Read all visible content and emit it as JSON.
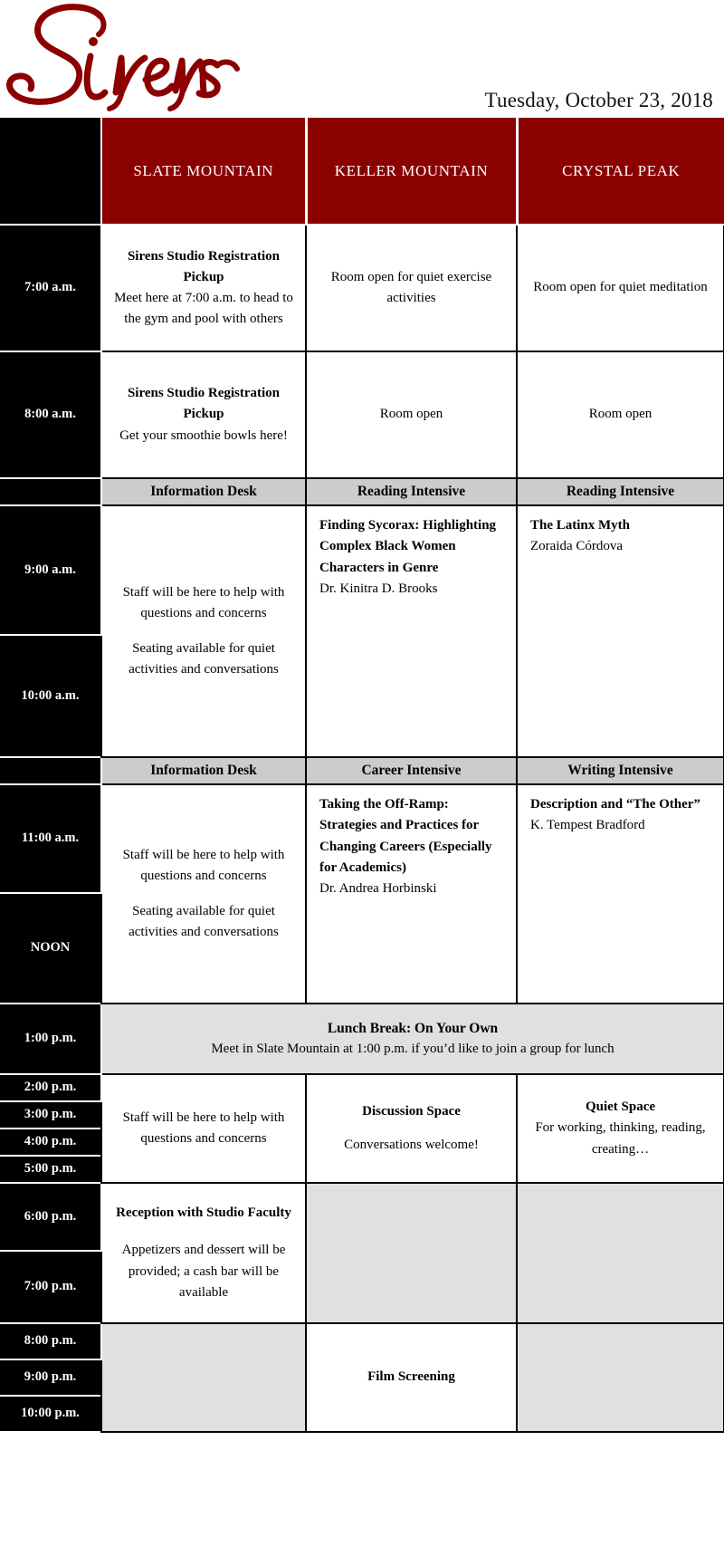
{
  "masthead": {
    "logo_text": "Sirens",
    "logo_icon": "sirens-script-logo",
    "date": "Tuesday, October 23, 2018",
    "brand_color": "#8B0000"
  },
  "colors": {
    "header_red": "#8B0000",
    "time_black": "#000000",
    "banner_gray": "#CCCCCC",
    "closed_gray": "#E0E0E0",
    "white": "#FFFFFF"
  },
  "columns": [
    {
      "key": "time",
      "label": ""
    },
    {
      "key": "slate",
      "label": "SLATE MOUNTAIN"
    },
    {
      "key": "keller",
      "label": "KELLER MOUNTAIN"
    },
    {
      "key": "crystal",
      "label": "CRYSTAL PEAK"
    }
  ],
  "times": {
    "t7": "7:00 a.m.",
    "t8": "8:00 a.m.",
    "t9": "9:00 a.m.",
    "t10": "10:00 a.m.",
    "t11": "11:00 a.m.",
    "noon": "NOON",
    "t13": "1:00 p.m.",
    "t14": "2:00 p.m.",
    "t15": "3:00 p.m.",
    "t16": "4:00 p.m.",
    "t17": "5:00 p.m.",
    "t18": "6:00 p.m.",
    "t19": "7:00 p.m.",
    "t20": "8:00 p.m.",
    "t21": "9:00 p.m.",
    "t22": "10:00 p.m."
  },
  "blocks": {
    "seven": {
      "slate_title": "Sirens Studio Registration Pickup",
      "slate_desc": "Meet here at 7:00 a.m. to head to the gym and pool with others",
      "keller": "Room open for quiet exercise activities",
      "crystal": "Room open for quiet meditation"
    },
    "eight": {
      "slate_title": "Sirens Studio Registration Pickup",
      "slate_desc": "Get your smoothie bowls here!",
      "keller": "Room open",
      "crystal": "Room open"
    },
    "morning_banner": {
      "slate": "Information Desk",
      "keller": "Reading Intensive",
      "crystal": "Reading Intensive"
    },
    "morning": {
      "slate_p1": "Staff will be here to help with questions and concerns",
      "slate_p2": "Seating available for quiet activities and conversations",
      "keller_title": "Finding Sycorax: Highlighting Complex Black Women Characters in Genre",
      "keller_presenter": "Dr. Kinitra D. Brooks",
      "crystal_title": "The Latinx Myth",
      "crystal_presenter": "Zoraida Córdova"
    },
    "midday_banner": {
      "slate": "Information Desk",
      "keller": "Career Intensive",
      "crystal": "Writing Intensive"
    },
    "midday": {
      "slate_p1": "Staff will be here to help with questions and concerns",
      "slate_p2": "Seating available for quiet activities and conversations",
      "keller_title": "Taking the Off-Ramp: Strategies and Practices for Changing Careers (Especially for Academics)",
      "keller_presenter": "Dr. Andrea Horbinski",
      "crystal_title": "Description and “The Other”",
      "crystal_presenter": "K. Tempest Bradford"
    },
    "lunch": {
      "title": "Lunch Break: On Your Own",
      "desc": "Meet in Slate Mountain at 1:00 p.m. if you’d like to join a group for lunch"
    },
    "afternoon": {
      "slate": "Staff will be here to help with questions and concerns",
      "keller_title": "Discussion Space",
      "keller_desc": "Conversations welcome!",
      "crystal_title": "Quiet Space",
      "crystal_desc": "For working, thinking, reading, creating…"
    },
    "evening": {
      "slate_title": "Reception with Studio Faculty",
      "slate_desc": "Appetizers and dessert will be provided; a cash bar will be available",
      "keller": "",
      "crystal": ""
    },
    "night": {
      "slate": "",
      "keller": "Film Screening",
      "crystal": ""
    }
  }
}
